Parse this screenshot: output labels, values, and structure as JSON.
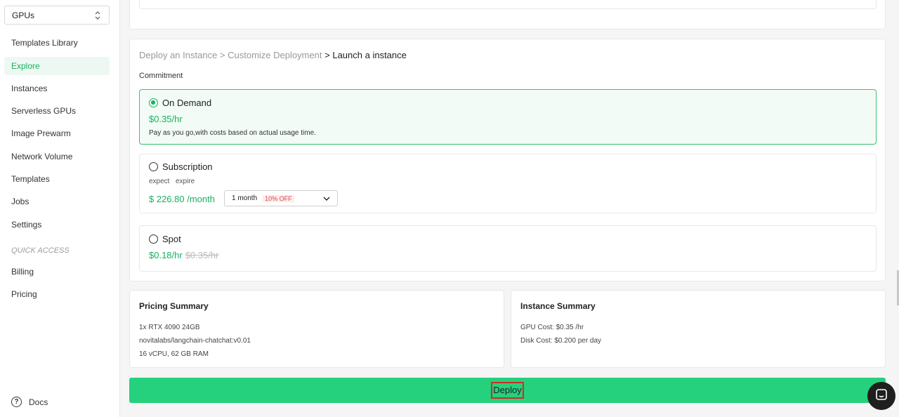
{
  "sidebar": {
    "selector": "GPUs",
    "items": [
      {
        "label": "Templates Library"
      },
      {
        "label": "Explore"
      },
      {
        "label": "Instances"
      },
      {
        "label": "Serverless GPUs"
      },
      {
        "label": "Image Prewarm"
      },
      {
        "label": "Network Volume"
      },
      {
        "label": "Templates"
      },
      {
        "label": "Jobs"
      },
      {
        "label": "Settings"
      }
    ],
    "quick_access_label": "QUICK ACCESS",
    "quick_items": [
      {
        "label": "Billing"
      },
      {
        "label": "Pricing"
      }
    ],
    "docs": "Docs"
  },
  "breadcrumb": {
    "step1": "Deploy an Instance",
    "sep1": " > ",
    "step2": "Customize Deployment",
    "sep2": " > ",
    "step3": "Launch a instance"
  },
  "commitment": {
    "label": "Commitment",
    "on_demand": {
      "title": "On Demand",
      "price": "$0.35/hr",
      "desc": "Pay as you go,with costs based on actual usage time."
    },
    "subscription": {
      "title": "Subscription",
      "expect": "expect",
      "expire": "expire",
      "price": "$ 226.80 /month",
      "duration": "1 month",
      "discount": "10% OFF"
    },
    "spot": {
      "title": "Spot",
      "price": "$0.18/hr",
      "original_price": "$0.35/hr"
    }
  },
  "pricing_summary": {
    "title": "Pricing Summary",
    "lines": [
      "1x RTX 4090 24GB",
      "novitalabs/langchain-chatchat:v0.01",
      "16 vCPU, 62 GB RAM"
    ]
  },
  "instance_summary": {
    "title": "Instance Summary",
    "lines": [
      "GPU Cost: $0.35 /hr",
      "Disk Cost: $0.200 per day"
    ]
  },
  "deploy_label": "Deploy",
  "colors": {
    "accent": "#17b15f",
    "deploy_button": "#25d17c",
    "discount": "#e04545"
  }
}
